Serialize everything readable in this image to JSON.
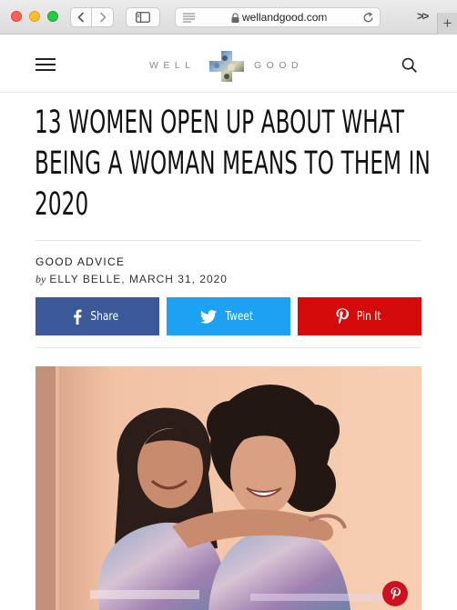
{
  "browser": {
    "url": "wellandgood.com",
    "overflow_chevrons": ">>",
    "new_tab": "+"
  },
  "site": {
    "logo_left": "WELL",
    "logo_right": "GOOD"
  },
  "article": {
    "headline": "13 women open up about what being a woman means to them in 2020",
    "category": "GOOD ADVICE",
    "byline_prefix": "by",
    "byline": "ELLY BELLE, MARCH 31, 2020"
  },
  "share": {
    "facebook_label": "Share",
    "twitter_label": "Tweet",
    "pinterest_label": "Pin It"
  },
  "colors": {
    "facebook": "#3b5998",
    "twitter": "#1da1f2",
    "pinterest": "#d50a0a"
  },
  "icons": [
    "back-arrow-icon",
    "forward-arrow-icon",
    "sidebar-icon",
    "reader-icon",
    "lock-icon",
    "reload-icon",
    "hamburger-menu-icon",
    "search-icon",
    "facebook-icon",
    "twitter-icon",
    "pinterest-icon"
  ]
}
